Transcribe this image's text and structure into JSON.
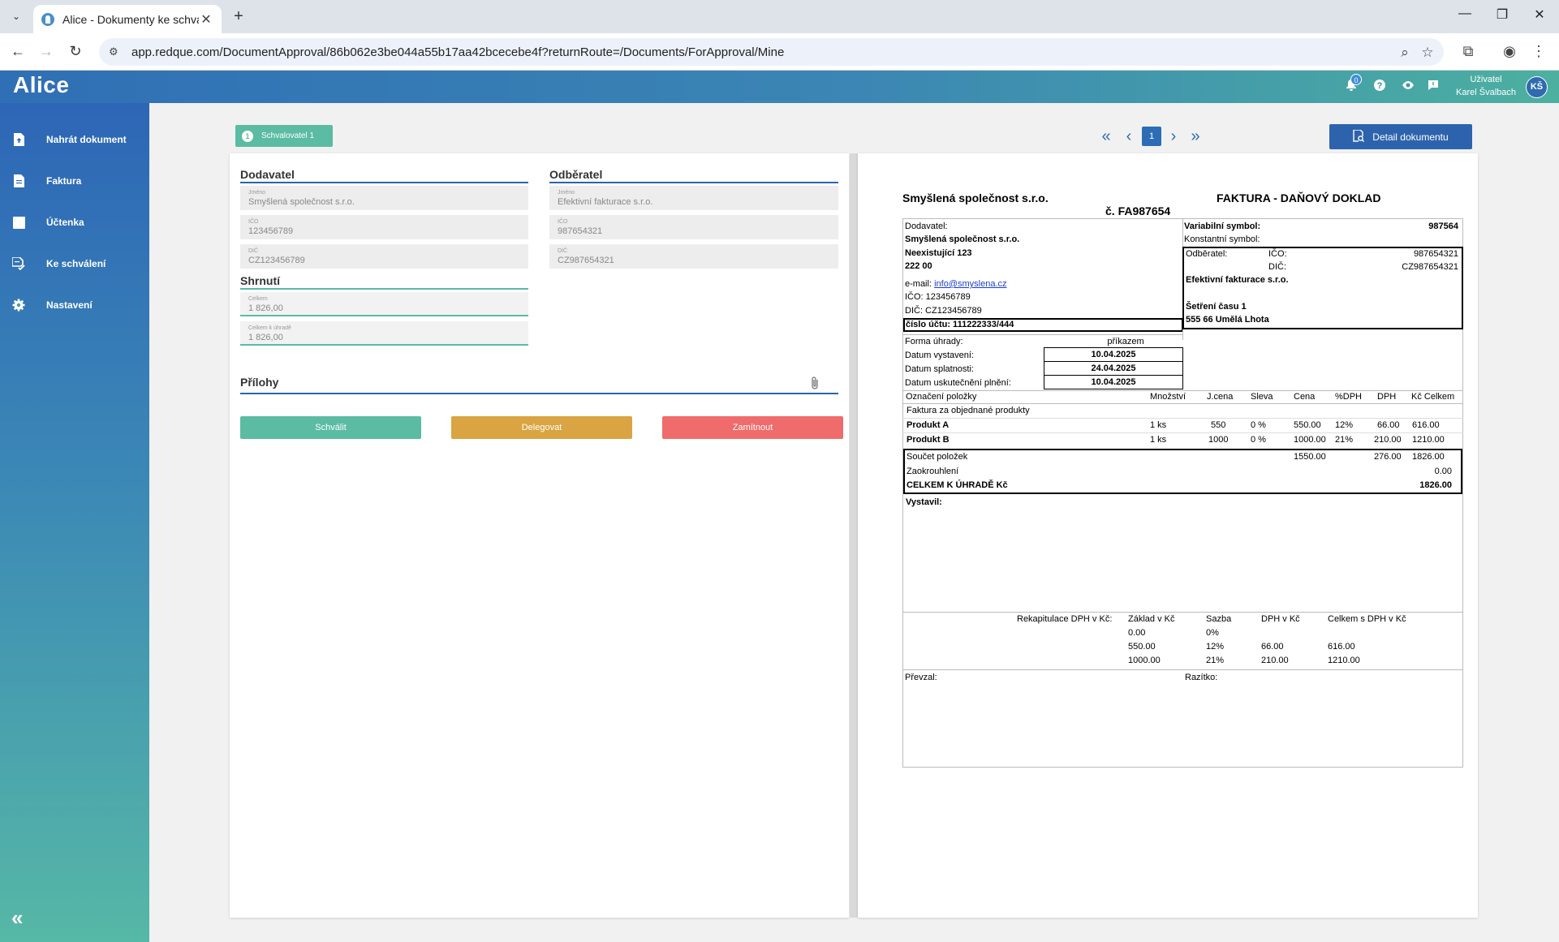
{
  "browser": {
    "tab_title": "Alice - Dokumenty ke schválení",
    "url": "app.redque.com/DocumentApproval/86b062e3be044a55b17aa42bcecebe4f?returnRoute=/Documents/ForApproval/Mine"
  },
  "header": {
    "logo": "Alice",
    "notification_count": "0",
    "user_role": "Uživatel",
    "user_name": "Karel Švalbach",
    "user_initials": "KŠ"
  },
  "sidebar": {
    "items": [
      {
        "label": "Nahrát dokument",
        "icon": "upload-document-icon"
      },
      {
        "label": "Faktura",
        "icon": "invoice-icon"
      },
      {
        "label": "Účtenka",
        "icon": "receipt-icon"
      },
      {
        "label": "Ke schválení",
        "icon": "approval-icon"
      },
      {
        "label": "Nastavení",
        "icon": "gear-icon"
      }
    ]
  },
  "toolbar": {
    "approver_number": "1",
    "approver_label": "Schvalovatel 1",
    "current_page": "1",
    "detail_button": "Detail dokumentu"
  },
  "form": {
    "supplier": {
      "title": "Dodavatel",
      "name_label": "Jméno",
      "name": "Smyšlená společnost s.r.o.",
      "ico_label": "IČO",
      "ico": "123456789",
      "dic_label": "DIČ",
      "dic": "CZ123456789"
    },
    "customer": {
      "title": "Odběratel",
      "name_label": "Jméno",
      "name": "Efektivní fakturace s.r.o.",
      "ico_label": "IČO",
      "ico": "987654321",
      "dic_label": "DIČ",
      "dic": "CZ987654321"
    },
    "summary": {
      "title": "Shrnutí",
      "total_label": "Celkem",
      "total": "1 826,00",
      "to_pay_label": "Celkem k úhradě",
      "to_pay": "1 826,00"
    },
    "attachments_title": "Přílohy",
    "buttons": {
      "approve": "Schválit",
      "delegate": "Delegovat",
      "reject": "Zamítnout"
    },
    "colors": {
      "approve": "#5bbba3",
      "delegate": "#d9a441",
      "reject": "#f06b6b"
    }
  },
  "invoice": {
    "company": "Smyšlená společnost s.r.o.",
    "doc_title": "FAKTURA - DAŇOVÝ DOKLAD",
    "doc_number": "č. FA987654",
    "supplier_label": "Dodavatel:",
    "supplier_name": "Smyšlená společnost s.r.o.",
    "supplier_street": "Neexistující 123",
    "supplier_zip": "222 00",
    "email_label": "e-mail:",
    "email": "info@smyslena.cz",
    "ico_line": "IČO: 123456789",
    "dic_line": "DIČ: CZ123456789",
    "account": "číslo účtu: 111222333/444",
    "var_symbol_label": "Variabilní symbol:",
    "var_symbol": "987564",
    "const_symbol_label": "Konstantní symbol:",
    "customer_label": "Odběratel:",
    "customer_ico_label": "IČO:",
    "customer_ico": "987654321",
    "customer_dic_label": "DIČ:",
    "customer_dic": "CZ987654321",
    "customer_name": "Efektivní fakturace s.r.o.",
    "customer_street": "Šetření času 1",
    "customer_city": "555 66 Umělá Lhota",
    "payment_form_label": "Forma úhrady:",
    "payment_form": "příkazem",
    "issue_date_label": "Datum vystavení:",
    "issue_date": "10.04.2025",
    "due_date_label": "Datum splatnosti:",
    "due_date": "24.04.2025",
    "supply_date_label": "Datum uskutečnění plnění:",
    "supply_date": "10.04.2025",
    "columns": [
      "Označení položky",
      "Množství",
      "J.cena",
      "Sleva",
      "Cena",
      "%DPH",
      "DPH",
      "Kč Celkem"
    ],
    "items_intro": "Faktura za objednané produkty",
    "items": [
      {
        "name": "Produkt A",
        "qty": "1 ks",
        "unit": "550",
        "discount": "0 %",
        "price": "550.00",
        "vat_rate": "12%",
        "vat": "66.00",
        "total": "616.00"
      },
      {
        "name": "Produkt B",
        "qty": "1 ks",
        "unit": "1000",
        "discount": "0 %",
        "price": "1000.00",
        "vat_rate": "21%",
        "vat": "210.00",
        "total": "1210.00"
      }
    ],
    "sum_label": "Součet položek",
    "sum_price": "1550.00",
    "sum_vat": "276.00",
    "sum_total": "1826.00",
    "rounding_label": "Zaokrouhlení",
    "rounding": "0.00",
    "grand_label": "CELKEM K ÚHRADĚ Kč",
    "grand_total": "1826.00",
    "issued_by_label": "Vystavil:",
    "recap_label": "Rekapitulace DPH v Kč:",
    "recap_columns": [
      "Základ v Kč",
      "Sazba",
      "DPH v Kč",
      "Celkem s DPH v Kč"
    ],
    "recap_rows": [
      {
        "base": "0.00",
        "rate": "0%",
        "vat": "",
        "total": ""
      },
      {
        "base": "550.00",
        "rate": "12%",
        "vat": "66.00",
        "total": "616.00"
      },
      {
        "base": "1000.00",
        "rate": "21%",
        "vat": "210.00",
        "total": "1210.00"
      }
    ],
    "received_label": "Převzal:",
    "stamp_label": "Razítko:"
  }
}
